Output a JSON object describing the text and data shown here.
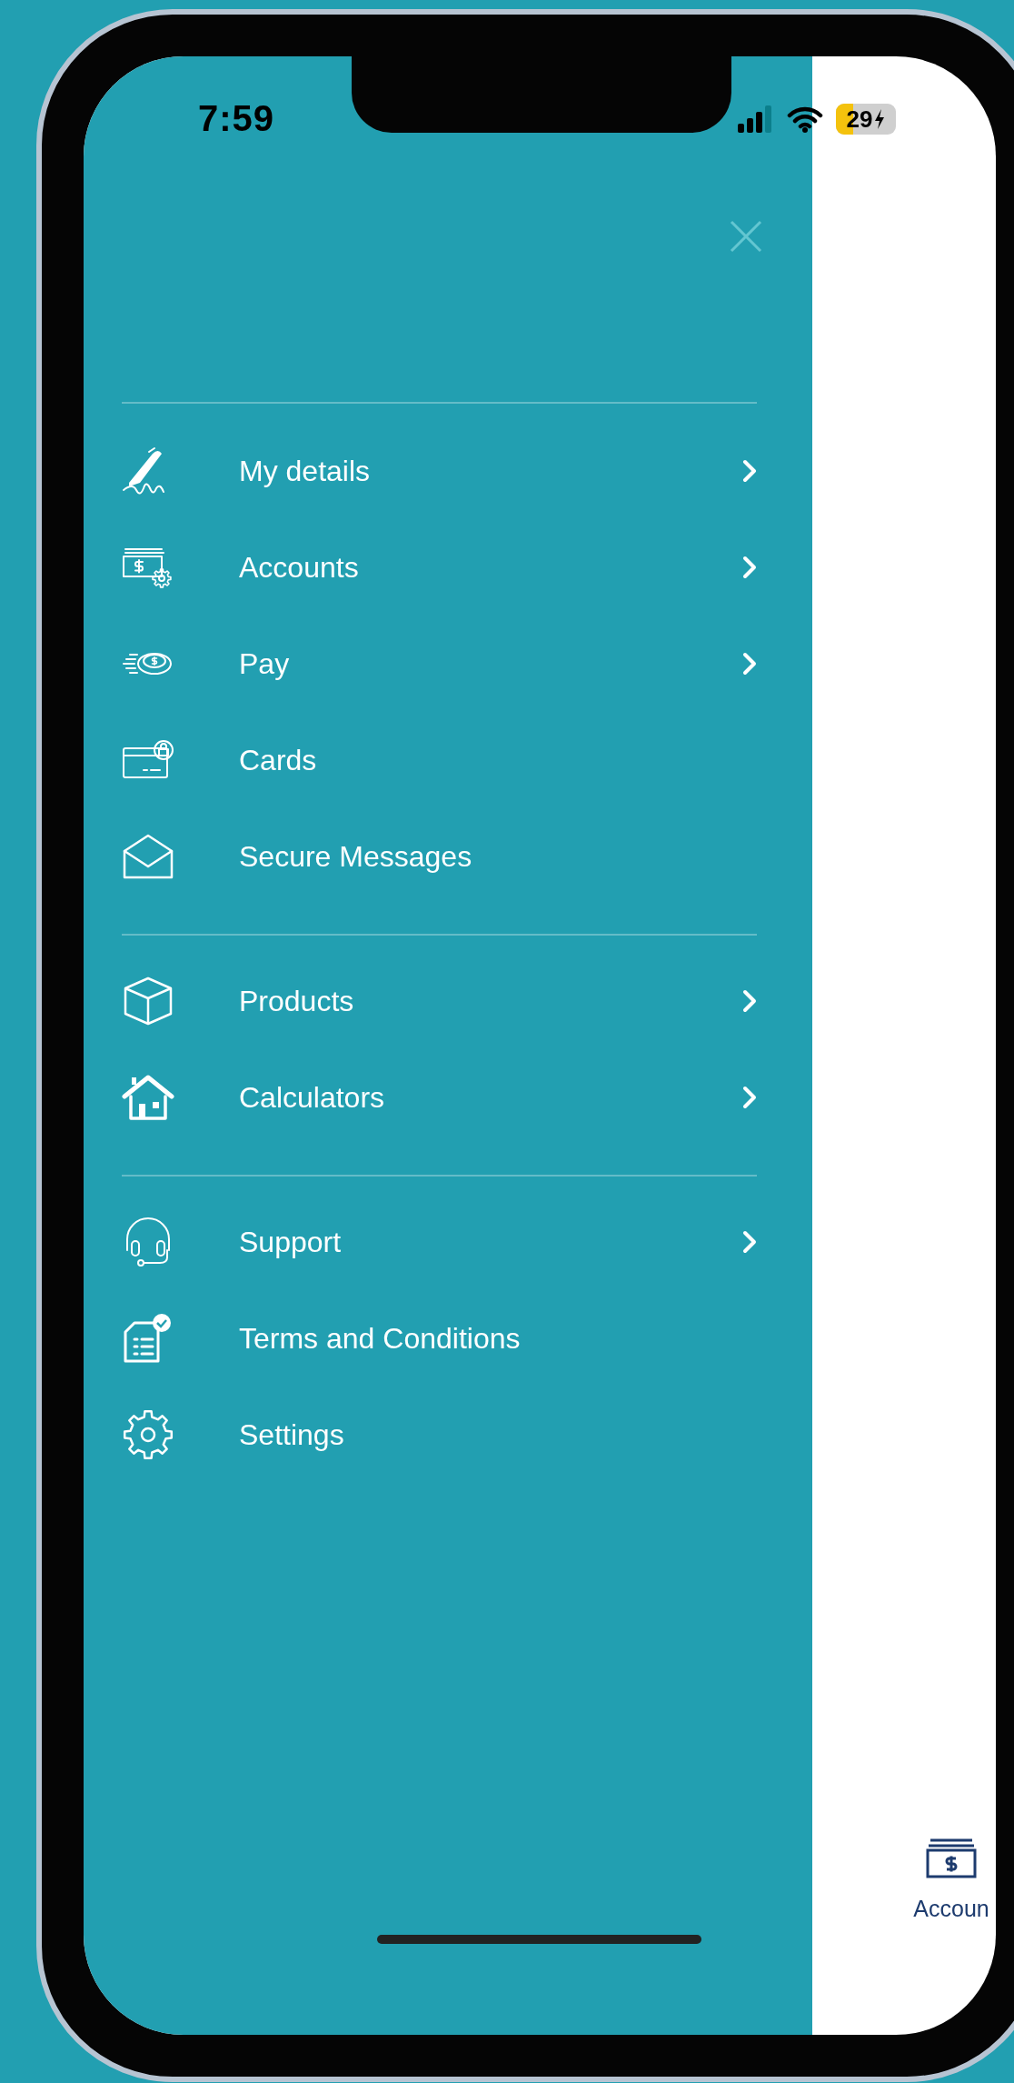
{
  "status_bar": {
    "time": "7:59",
    "battery": {
      "percent": "29",
      "level": 0.29,
      "charging": true
    }
  },
  "menu": {
    "sections": [
      {
        "items": [
          {
            "label": "My details",
            "has_submenu": true
          },
          {
            "label": "Accounts",
            "has_submenu": true
          },
          {
            "label": "Pay",
            "has_submenu": true
          },
          {
            "label": "Cards",
            "has_submenu": false
          },
          {
            "label": "Secure Messages",
            "has_submenu": false
          }
        ]
      },
      {
        "items": [
          {
            "label": "Products",
            "has_submenu": true
          },
          {
            "label": "Calculators",
            "has_submenu": true
          }
        ]
      },
      {
        "items": [
          {
            "label": "Support",
            "has_submenu": true
          },
          {
            "label": "Terms and Conditions",
            "has_submenu": false
          },
          {
            "label": "Settings",
            "has_submenu": false
          }
        ]
      }
    ]
  },
  "behind_screen": {
    "tab_label": "Accoun"
  }
}
